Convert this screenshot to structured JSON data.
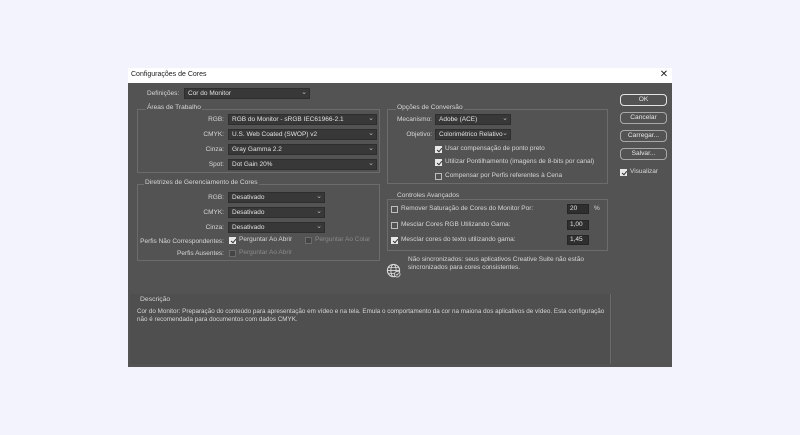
{
  "window": {
    "title": "Configurações de Cores",
    "close_glyph": "✕"
  },
  "settings": {
    "label": "Definições:",
    "value": "Cor do Monitor"
  },
  "workspaces": {
    "title": "Áreas de Trabalho",
    "rgb_label": "RGB:",
    "rgb_value": "RGB do Monitor - sRGB IEC61966-2.1",
    "cmyk_label": "CMYK:",
    "cmyk_value": "U.S. Web Coated (SWOP) v2",
    "gray_label": "Cinza:",
    "gray_value": "Gray Gamma 2.2",
    "spot_label": "Spot:",
    "spot_value": "Dot Gain 20%"
  },
  "policies": {
    "title": "Diretrizes de Gerenciamento de Cores",
    "rgb_label": "RGB:",
    "rgb_value": "Desativado",
    "cmyk_label": "CMYK:",
    "cmyk_value": "Desativado",
    "gray_label": "Cinza:",
    "gray_value": "Desativado",
    "mismatch_label": "Perfis Não Correspondentes:",
    "ask_open": "Perguntar Ao Abrir",
    "ask_paste": "Perguntar Ao Colar",
    "missing_label": "Perfis Ausentes:",
    "missing_ask_open": "Perguntar Ao Abrir"
  },
  "conversion": {
    "title": "Opções de Conversão",
    "engine_label": "Mecanismo:",
    "engine_value": "Adobe (ACE)",
    "intent_label": "Objetivo:",
    "intent_value": "Colorimétrico Relativo",
    "black_point": "Usar compensação de ponto preto",
    "dither": "Utilizar Pontilhamento (imagens de 8-bits por canal)",
    "scene": "Compensar por Perfis referentes à Cena"
  },
  "advanced": {
    "title": "Controles Avançados",
    "desaturate_label": "Remover Saturação de Cores do Monitor Por:",
    "desaturate_value": "20",
    "desaturate_unit": "%",
    "blend_rgb_label": "Mesclar Cores RGB Utilizando Gama:",
    "blend_rgb_value": "1,00",
    "blend_text_label": "Mesclar cores do texto utilizando gama:",
    "blend_text_value": "1,45"
  },
  "sync_status": "Não sincronizados: seus aplicativos Creative Suite não estão sincronizados para cores consistentes.",
  "description": {
    "title": "Descrição",
    "text": "Cor do Monitor: Preparação do conteúdo para apresentação em vídeo e na tela. Emula o comportamento da cor na maiona dos aplicativos de vídeo. Esta configuração não é recomendada para documentos com dados CMYK."
  },
  "buttons": {
    "ok": "OK",
    "cancel": "Cancelar",
    "load": "Carregar...",
    "save": "Salvar..."
  },
  "preview": {
    "label": "Visualizar",
    "checked": true
  },
  "icons": {
    "sync": "globe-sync-icon",
    "dropdown": "chevron-down-icon",
    "close": "close-icon"
  }
}
